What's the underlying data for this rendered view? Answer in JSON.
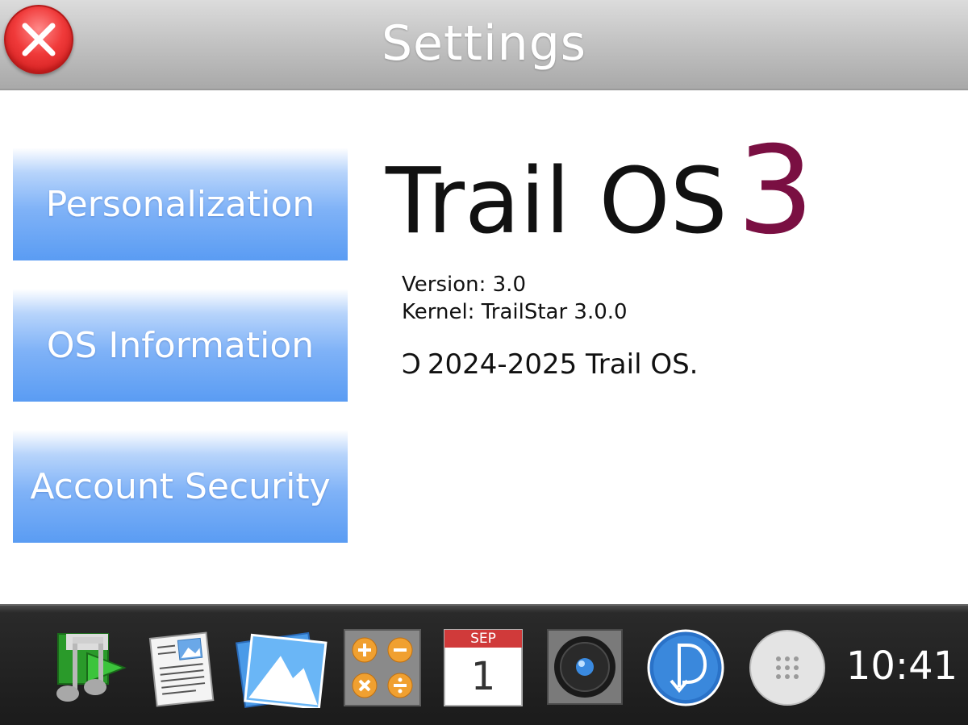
{
  "window": {
    "title": "Settings",
    "close_icon": "close-icon"
  },
  "sidebar": {
    "items": [
      {
        "label": "Personalization"
      },
      {
        "label": "OS Information"
      },
      {
        "label": "Account Security"
      }
    ]
  },
  "os_info": {
    "brand_name": "Trail OS",
    "brand_version": "3",
    "version_line": "Version: 3.0",
    "kernel_line": "Kernel: TrailStar 3.0.0",
    "copyright_symbol": "Ↄ",
    "copyright_text": "2024-2025 Trail OS."
  },
  "taskbar": {
    "apps": [
      {
        "icon": "music-player-icon"
      },
      {
        "icon": "document-viewer-icon"
      },
      {
        "icon": "photos-icon"
      },
      {
        "icon": "calculator-icon"
      },
      {
        "icon": "calendar-icon",
        "month": "SEP",
        "day": "1"
      },
      {
        "icon": "camera-icon"
      },
      {
        "icon": "downloader-icon"
      },
      {
        "icon": "app-drawer-icon"
      }
    ],
    "clock": "10:41"
  },
  "colors": {
    "menu_button_blue": "#5a9cf3",
    "brand_number": "#7a0f42",
    "close_red": "#e53030",
    "taskbar_bg": "#1b1b1b"
  }
}
